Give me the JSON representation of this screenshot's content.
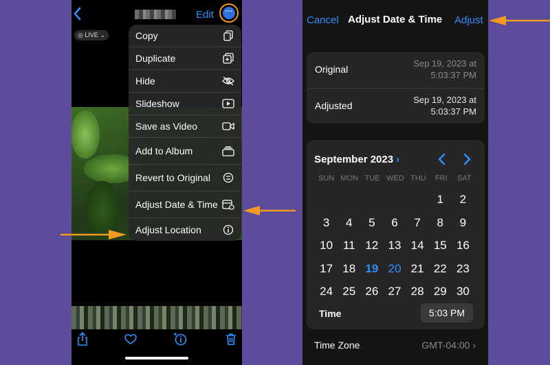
{
  "left_phone": {
    "header": {
      "edit_label": "Edit",
      "more_icon": "ellipsis-circle-icon",
      "back_icon": "chevron-left-icon"
    },
    "live_badge": "LIVE",
    "menu": [
      {
        "label": "Copy",
        "icon": "copy-icon"
      },
      {
        "label": "Duplicate",
        "icon": "duplicate-icon"
      },
      {
        "label": "Hide",
        "icon": "eye-slash-icon"
      },
      {
        "label": "Slideshow",
        "icon": "play-rectangle-icon"
      },
      {
        "label": "Save as Video",
        "icon": "video-icon"
      },
      {
        "label": "Add to Album",
        "icon": "album-icon"
      },
      {
        "label": "Revert to Original",
        "icon": "revert-icon"
      },
      {
        "label": "Adjust Date & Time",
        "icon": "calendar-clock-icon"
      },
      {
        "label": "Adjust Location",
        "icon": "info-circle-icon"
      }
    ],
    "toolbar": [
      "share-icon",
      "heart-icon",
      "info-sparkle-icon",
      "trash-icon"
    ]
  },
  "right_phone": {
    "header": {
      "cancel_label": "Cancel",
      "title": "Adjust Date & Time",
      "adjust_label": "Adjust"
    },
    "original": {
      "label": "Original",
      "date": "Sep 19, 2023 at",
      "time": "5:03:37 PM"
    },
    "adjusted": {
      "label": "Adjusted",
      "date": "Sep 19, 2023 at",
      "time": "5:03:37 PM"
    },
    "calendar": {
      "month_label": "September 2023",
      "weekdays": [
        "SUN",
        "MON",
        "TUE",
        "WED",
        "THU",
        "FRI",
        "SAT"
      ],
      "weeks": [
        [
          "",
          "",
          "",
          "",
          "",
          "1",
          "2"
        ],
        [
          "3",
          "4",
          "5",
          "6",
          "7",
          "8",
          "9"
        ],
        [
          "10",
          "11",
          "12",
          "13",
          "14",
          "15",
          "16"
        ],
        [
          "17",
          "18",
          "19",
          "20",
          "21",
          "22",
          "23"
        ],
        [
          "24",
          "25",
          "26",
          "27",
          "28",
          "29",
          "30"
        ]
      ],
      "selected_day": "19",
      "today_day": "20"
    },
    "time": {
      "label": "Time",
      "value": "5:03 PM"
    },
    "time_zone": {
      "label": "Time Zone",
      "value": "GMT-04:00"
    }
  },
  "colors": {
    "accent": "#2f8fff",
    "annotation_orange": "#f39a22",
    "background": "#5b4b9a"
  }
}
